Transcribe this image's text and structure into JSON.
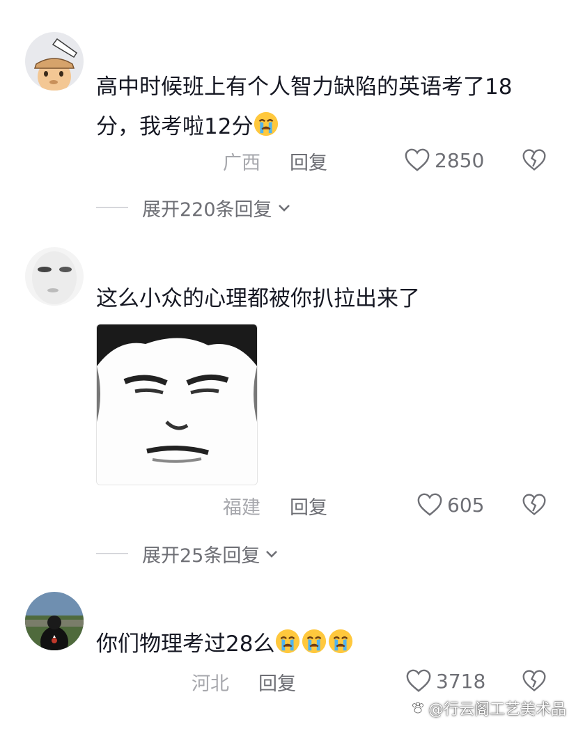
{
  "comments": [
    {
      "text": "高中时候班上有个人智力缺陷的英语考了18分，我考啦12分",
      "emojis": [
        "crying-emoji"
      ],
      "location": "广西",
      "reply_label": "回复",
      "likes": "2850",
      "expand_label": "展开220条回复"
    },
    {
      "text": "这么小众的心理都被你扒拉出来了",
      "location": "福建",
      "reply_label": "回复",
      "likes": "605",
      "expand_label": "展开25条回复"
    },
    {
      "text": "你们物理考过28么",
      "emojis": [
        "crying-emoji",
        "crying-emoji",
        "crying-emoji"
      ],
      "location": "河北",
      "reply_label": "回复",
      "likes": "3718"
    }
  ],
  "watermark": "@行云阁工艺美术品",
  "colors": {
    "text": "#161823",
    "meta": "#8a8b91",
    "divider": "#d6d7db"
  }
}
